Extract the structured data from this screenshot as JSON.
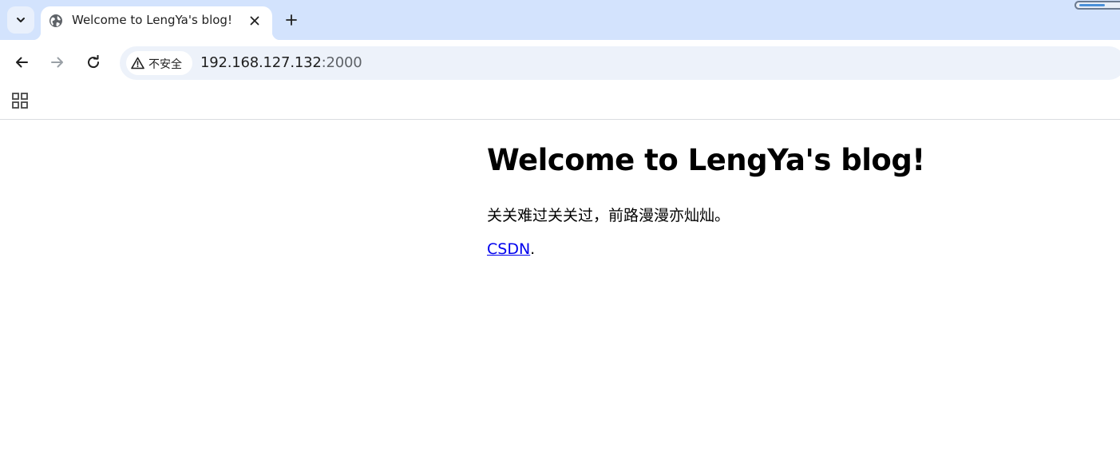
{
  "browser": {
    "tab": {
      "title": "Welcome to LengYa's blog!"
    },
    "omnibox": {
      "security_label": "不安全",
      "url_host": "192.168.127.132",
      "url_port": ":2000"
    },
    "icons": {
      "tab_search": "chevron-down-icon",
      "favicon": "globe-icon",
      "close": "close-icon",
      "new_tab": "plus-icon",
      "back": "arrow-left-icon",
      "forward": "arrow-right-icon",
      "reload": "reload-icon",
      "security": "warning-triangle-icon",
      "apps": "apps-grid-icon"
    },
    "colors": {
      "tabstrip_bg": "#d3e3fd",
      "omnibox_bg": "#edf2fa",
      "link": "#0000ee"
    }
  },
  "page": {
    "heading": "Welcome to LengYa's blog!",
    "paragraph": "关关难过关关过，前路漫漫亦灿灿。",
    "link_text": "CSDN",
    "link_suffix": "."
  }
}
